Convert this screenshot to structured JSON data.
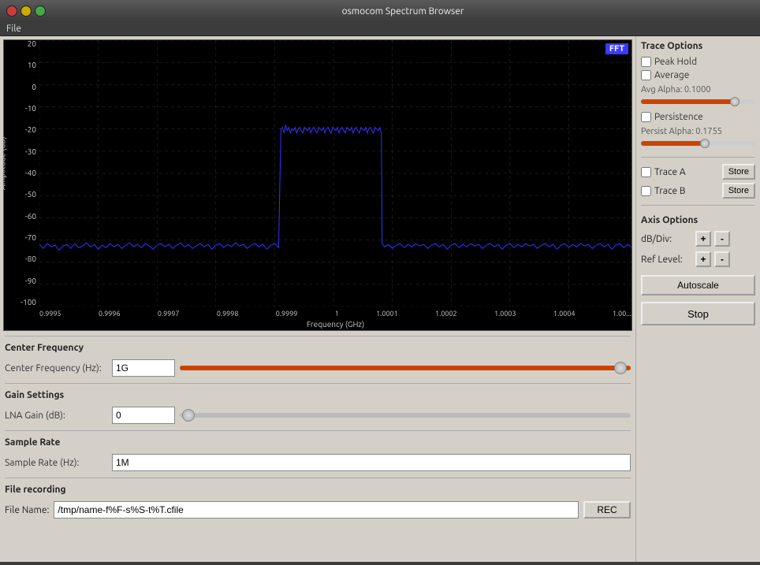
{
  "window": {
    "title": "osmocom Spectrum Browser"
  },
  "menu": {
    "file_label": "File"
  },
  "fft_badge": "FFT",
  "chart": {
    "y_labels": [
      "20",
      "10",
      "0",
      "-10",
      "-20",
      "-30",
      "-40",
      "-50",
      "-60",
      "-70",
      "-80",
      "-90",
      "-100"
    ],
    "y_axis_title": "Amplitude (dB)",
    "x_labels": [
      "0.9995",
      "0.9996",
      "0.9997",
      "0.9998",
      "0.9999",
      "1",
      "1.0001",
      "1.0002",
      "1.0003",
      "1.0004",
      "1.00..."
    ],
    "x_axis_title": "Frequency (GHz)"
  },
  "trace_options": {
    "title": "Trace Options",
    "peak_hold_label": "Peak Hold",
    "peak_hold_checked": false,
    "average_label": "Average",
    "average_checked": false,
    "avg_alpha_label": "Avg Alpha: 0.1000",
    "persistence_label": "Persistence",
    "persistence_checked": false,
    "persist_alpha_label": "Persist Alpha: 0.1755",
    "trace_a_label": "Trace A",
    "trace_a_checked": false,
    "store_a_label": "Store",
    "trace_b_label": "Trace B",
    "trace_b_checked": false,
    "store_b_label": "Store"
  },
  "axis_options": {
    "title": "Axis Options",
    "db_div_label": "dB/Div:",
    "ref_level_label": "Ref Level:",
    "plus_label": "+",
    "minus_label": "-",
    "autoscale_label": "Autoscale"
  },
  "stop_button": "Stop",
  "center_freq": {
    "section_title": "Center Frequency",
    "label": "Center Frequency (Hz):",
    "value": "1G"
  },
  "gain": {
    "section_title": "Gain Settings",
    "label": "LNA Gain (dB):",
    "value": "0"
  },
  "sample_rate": {
    "section_title": "Sample Rate",
    "label": "Sample Rate (Hz):",
    "value": "1M"
  },
  "file_recording": {
    "section_title": "File recording",
    "label": "File Name:",
    "value": "/tmp/name-f%F-s%S-t%T.cfile",
    "rec_label": "REC"
  }
}
